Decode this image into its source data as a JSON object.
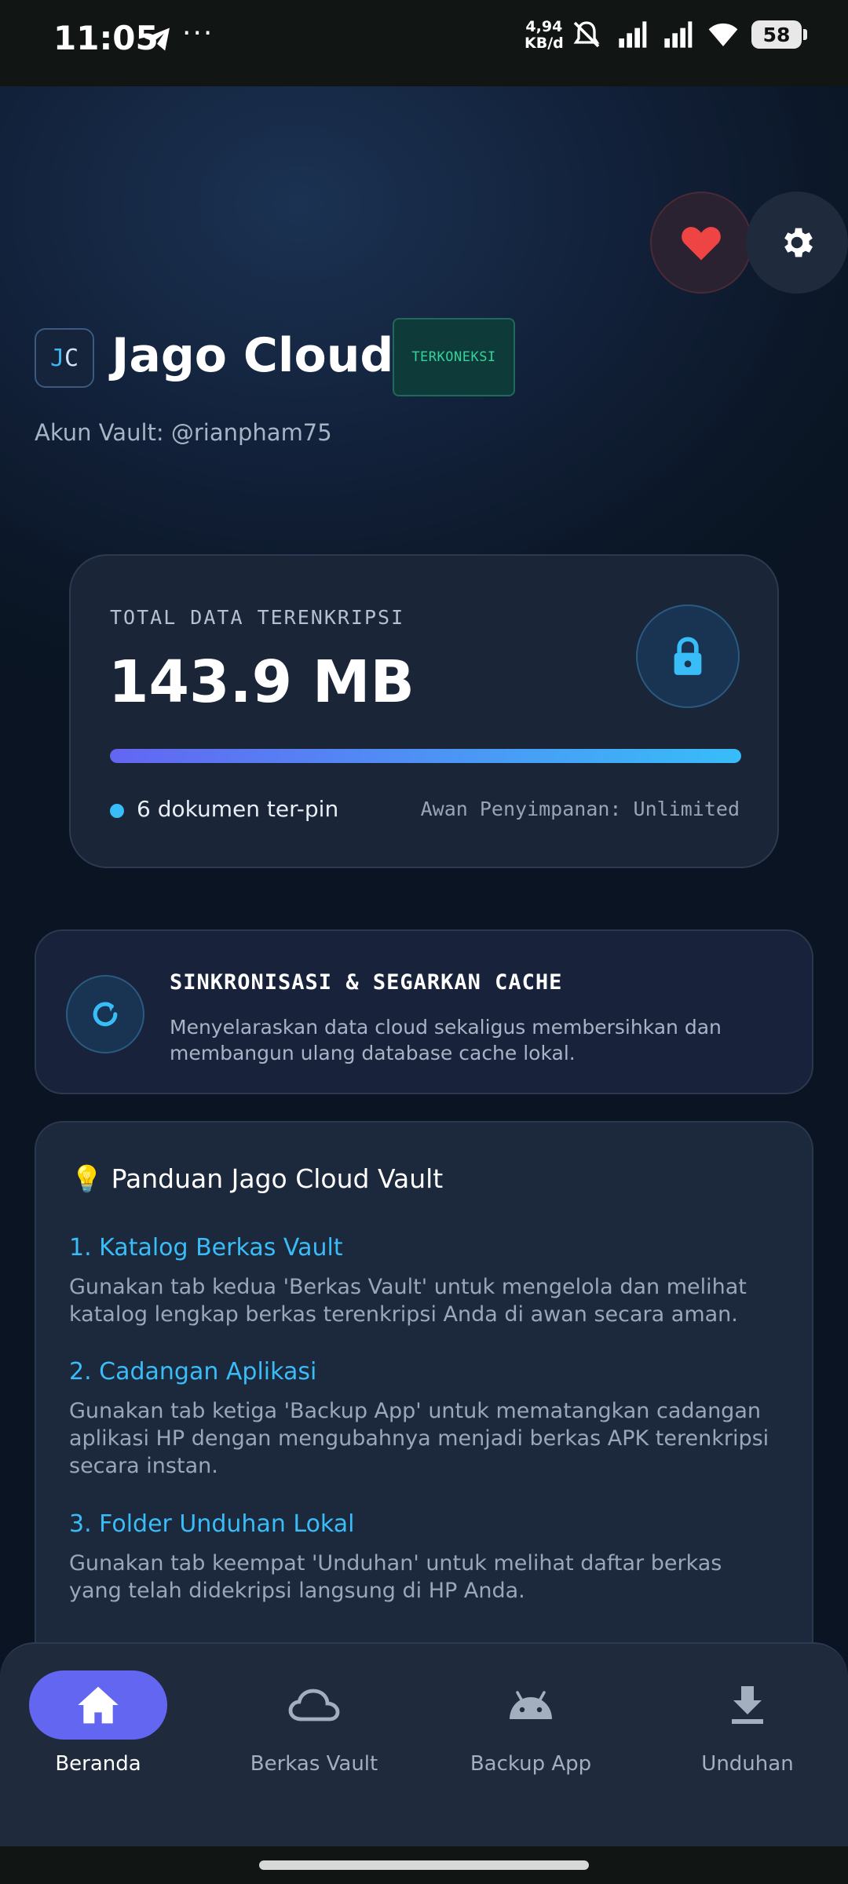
{
  "status_bar": {
    "time": "11:05",
    "net_speed_value": "4,94",
    "net_speed_unit": "KB/d",
    "battery": "58"
  },
  "header": {
    "logo_letter_1": "J",
    "logo_letter_2": "C",
    "title": "Jago Cloud",
    "status_badge": "TERKONEKSI",
    "account": "Akun Vault: @rianpham75"
  },
  "storage": {
    "label": "TOTAL DATA TERENKRIPSI",
    "value": "143.9 MB",
    "progress_fraction": 1.0,
    "pinned": "6 dokumen ter-pin",
    "cloud": "Awan Penyimpanan: Unlimited"
  },
  "sync": {
    "title": "SINKRONISASI & SEGARKAN CACHE",
    "description": "Menyelaraskan data cloud sekaligus membersihkan dan membangun ulang database cache lokal."
  },
  "guide": {
    "title": "💡 Panduan Jago Cloud Vault",
    "items": [
      {
        "title": "1. Katalog Berkas Vault",
        "desc": "Gunakan tab kedua 'Berkas Vault' untuk mengelola dan melihat katalog lengkap berkas terenkripsi Anda di awan secara aman."
      },
      {
        "title": "2. Cadangan Aplikasi",
        "desc": "Gunakan tab ketiga 'Backup App' untuk mematangkan cadangan aplikasi HP dengan mengubahnya menjadi berkas APK terenkripsi secara instan."
      },
      {
        "title": "3. Folder Unduhan Lokal",
        "desc": "Gunakan tab keempat 'Unduhan' untuk melihat daftar berkas yang telah didekripsi langsung di HP Anda."
      }
    ]
  },
  "nav": [
    {
      "label": "Beranda",
      "icon": "home-icon",
      "active": true
    },
    {
      "label": "Berkas Vault",
      "icon": "cloud-icon",
      "active": false
    },
    {
      "label": "Backup App",
      "icon": "android-icon",
      "active": false
    },
    {
      "label": "Unduhan",
      "icon": "download-icon",
      "active": false
    }
  ],
  "colors": {
    "accent": "#6366f1",
    "link": "#38bdf8",
    "connected": "#34d399",
    "heart": "#ef4444"
  }
}
